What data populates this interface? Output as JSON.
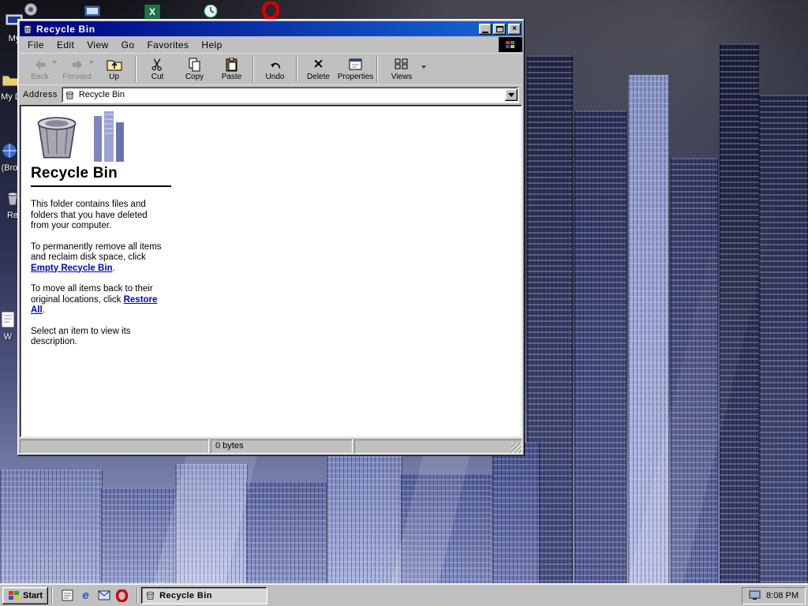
{
  "window": {
    "title": "Recycle Bin",
    "menus": {
      "file": "File",
      "edit": "Edit",
      "view": "View",
      "go": "Go",
      "favorites": "Favorites",
      "help": "Help"
    },
    "toolbar": {
      "back": "Back",
      "forward": "Forward",
      "up": "Up",
      "cut": "Cut",
      "copy": "Copy",
      "paste": "Paste",
      "undo": "Undo",
      "delete": "Delete",
      "properties": "Properties",
      "views": "Views"
    },
    "address": {
      "label": "Address",
      "value": "Recycle Bin"
    },
    "content": {
      "heading": "Recycle Bin",
      "para1": "This folder contains files and folders that you have deleted from your computer.",
      "para2_text": "To permanently remove all items and reclaim disk space, click ",
      "para2_link": "Empty Recycle Bin",
      "para2_end": ".",
      "para3_text": "To move all items back to their original locations, click ",
      "para3_link": "Restore All",
      "para3_end": ".",
      "para4": "Select an item to view its description."
    },
    "status": {
      "size": "0 bytes"
    }
  },
  "taskbar": {
    "start": "Start",
    "task": "Recycle Bin",
    "time": "8:08 PM"
  },
  "desktop": {
    "icons": {
      "i1": "My",
      "i2": "My D",
      "i3": "(Bro",
      "i4": "Re",
      "i5": "W"
    }
  }
}
